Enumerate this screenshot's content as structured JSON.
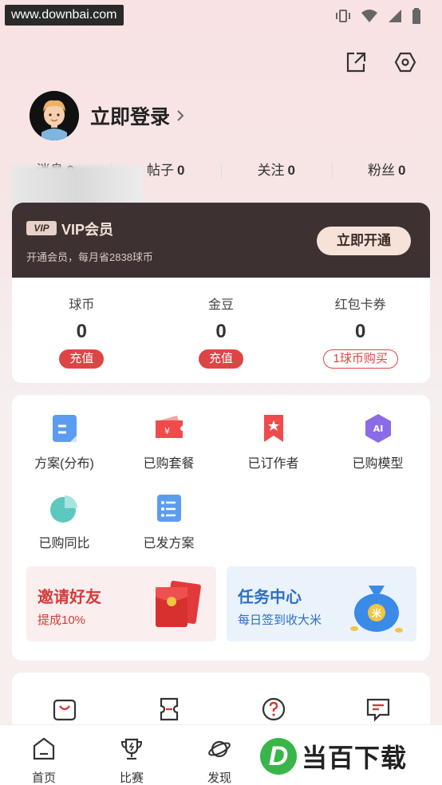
{
  "watermark": "www.downbai.com",
  "profile": {
    "login_label": "立即登录"
  },
  "stats": [
    {
      "label": "消息",
      "value": "0"
    },
    {
      "label": "帖子",
      "value": "0"
    },
    {
      "label": "关注",
      "value": "0"
    },
    {
      "label": "粉丝",
      "value": "0"
    }
  ],
  "vip": {
    "badge": "VIP",
    "title": "VIP会员",
    "subtitle": "开通会员，每月省2838球币",
    "button": "立即开通"
  },
  "wallet": [
    {
      "label": "球币",
      "value": "0",
      "action": "充值"
    },
    {
      "label": "金豆",
      "value": "0",
      "action": "充值"
    },
    {
      "label": "红包卡券",
      "value": "0",
      "action": "1球币购买"
    }
  ],
  "services": [
    {
      "label": "方案(分布)",
      "icon": "plan-doc-icon"
    },
    {
      "label": "已购套餐",
      "icon": "ticket-icon"
    },
    {
      "label": "已订作者",
      "icon": "bookmark-star-icon"
    },
    {
      "label": "已购模型",
      "icon": "ai-hexagon-icon"
    },
    {
      "label": "已购同比",
      "icon": "pie-chart-icon"
    },
    {
      "label": "已发方案",
      "icon": "list-doc-icon"
    }
  ],
  "promos": [
    {
      "title": "邀请好友",
      "subtitle": "提成10%",
      "color": "#d53b3b"
    },
    {
      "title": "任务中心",
      "subtitle": "每日签到收大米",
      "color": "#2c6fc4"
    }
  ],
  "coin_symbol": "米",
  "ai_label": "AI",
  "tabs": [
    {
      "label": "首页"
    },
    {
      "label": "比赛"
    },
    {
      "label": "发现"
    }
  ],
  "brand": {
    "letter": "D",
    "text": "当百下载"
  },
  "colors": {
    "accent_red": "#dd4545",
    "vip_dark": "#3d3231"
  }
}
